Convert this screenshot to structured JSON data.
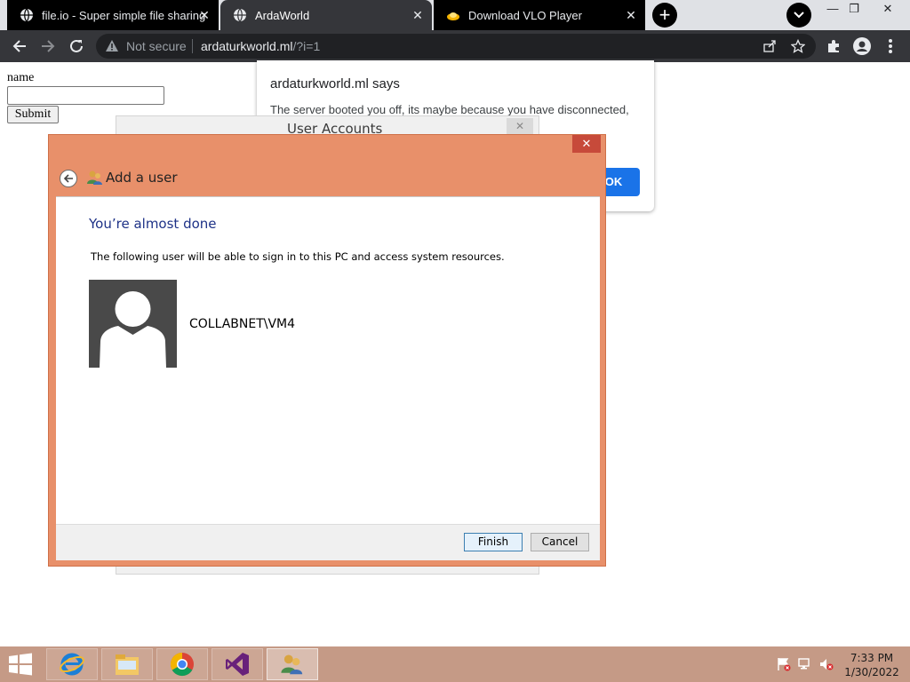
{
  "browser": {
    "tabs": [
      {
        "title": "file.io - Super simple file sharing",
        "icon": "globe-icon",
        "active": false
      },
      {
        "title": "ArdaWorld",
        "icon": "globe-icon",
        "active": true
      },
      {
        "title": "Download VLO Player",
        "icon": "vlc-icon",
        "active": false
      }
    ],
    "omnibox": {
      "security_label": "Not secure",
      "host": "ardaturkworld.ml",
      "path": "/?i=1"
    }
  },
  "page": {
    "name_label": "name",
    "name_value": "",
    "submit_label": "Submit"
  },
  "alert": {
    "title": "ardaturkworld.ml says",
    "message": "The server booted you off, its maybe because you have disconnected,",
    "ok_label": "OK"
  },
  "user_accounts": {
    "title": "User Accounts"
  },
  "add_user": {
    "header_title": "Add a user",
    "heading": "You’re almost done",
    "description": "The following user will be able to sign in to this PC and access system resources.",
    "username": "COLLABNET\\VM4",
    "finish_label": "Finish",
    "cancel_label": "Cancel"
  },
  "taskbar": {
    "items": [
      "internet-explorer",
      "file-explorer",
      "chrome",
      "visual-studio",
      "user-accounts"
    ],
    "clock_time": "7:33 PM",
    "clock_date": "1/30/2022"
  },
  "colors": {
    "dialog_accent": "#e8906a",
    "heading_blue": "#1e3287",
    "chrome_dark": "#35363a",
    "alert_ok": "#1a73e8",
    "taskbar": "#c59a86"
  }
}
